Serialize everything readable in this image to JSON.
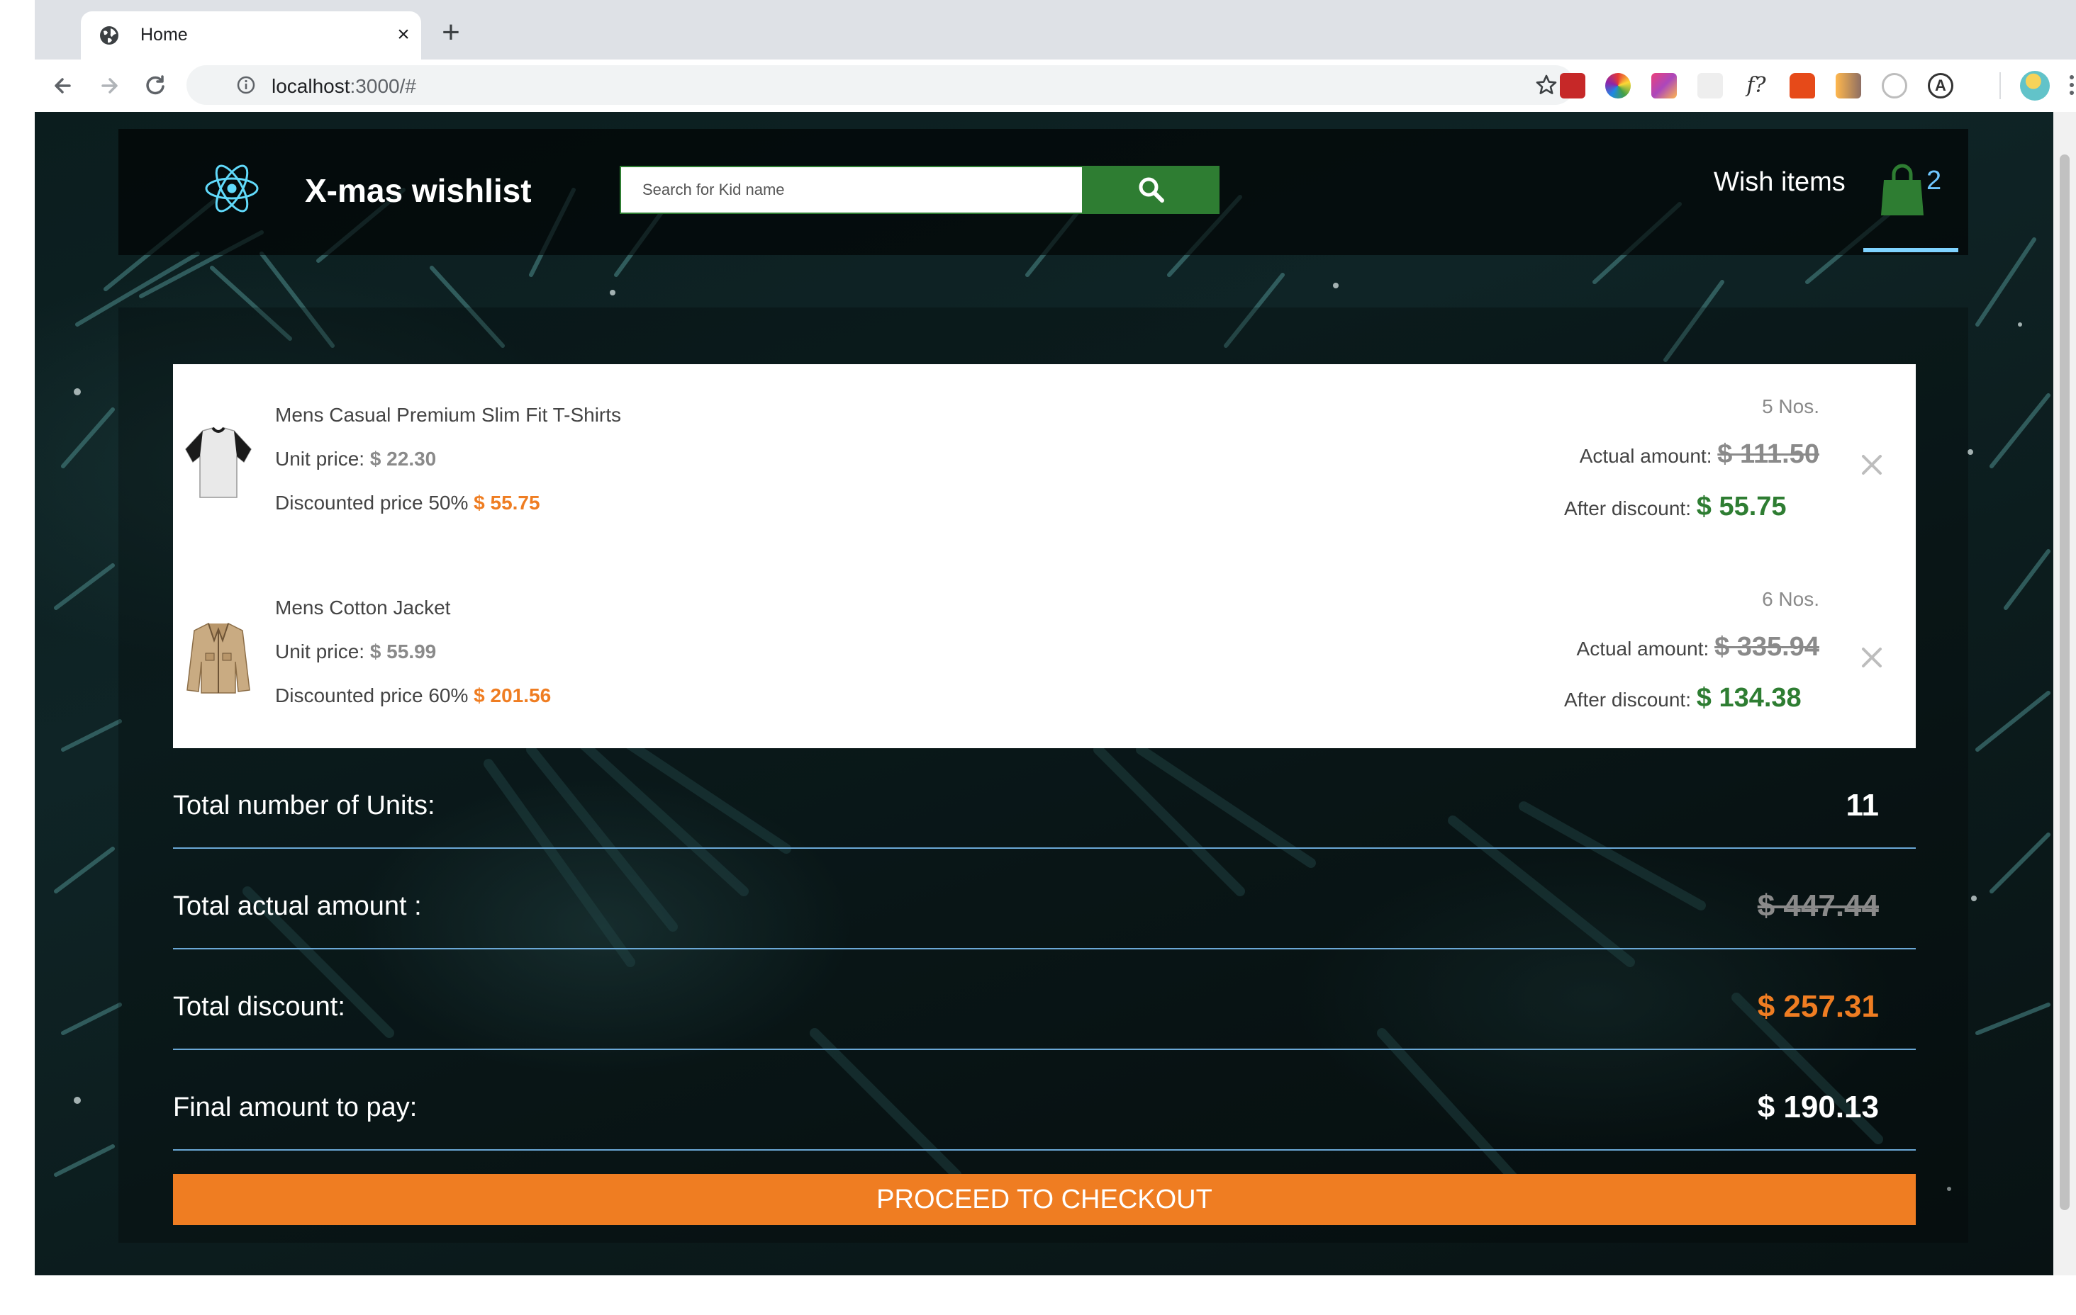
{
  "browser": {
    "tab_title": "Home",
    "url_host": "localhost",
    "url_rest": ":3000/#",
    "icons": [
      "globe-icon",
      "close-icon",
      "plus-icon",
      "back-icon",
      "forward-icon",
      "reload-icon",
      "info-icon",
      "star-icon",
      "kebab-icon"
    ]
  },
  "header": {
    "title": "X-mas wishlist",
    "search_placeholder": "Search for Kid name",
    "wish_label": "Wish items",
    "cart_count": "2",
    "accent_green": "#2e7d32"
  },
  "items": [
    {
      "name": "Mens Casual Premium Slim Fit T-Shirts",
      "unit_label": "Unit price:",
      "unit_price": "$ 22.30",
      "discount_label": "Discounted price 50%",
      "discount_value": "$ 55.75",
      "qty": "5 Nos.",
      "actual_label": "Actual amount:",
      "actual_amount": "$ 111.50",
      "after_label": "After discount:",
      "after_amount": "$ 55.75"
    },
    {
      "name": "Mens Cotton Jacket",
      "unit_label": "Unit price:",
      "unit_price": "$ 55.99",
      "discount_label": "Discounted price 60%",
      "discount_value": "$ 201.56",
      "qty": "6 Nos.",
      "actual_label": "Actual amount:",
      "actual_amount": "$ 335.94",
      "after_label": "After discount:",
      "after_amount": "$ 134.38"
    }
  ],
  "summary": {
    "units_label": "Total number of Units:",
    "units_value": "11",
    "actual_label": "Total actual amount :",
    "actual_value": "$ 447.44",
    "discount_label": "Total discount:",
    "discount_value": "$ 257.31",
    "final_label": "Final amount to pay:",
    "final_value": "$ 190.13"
  },
  "checkout_label": "PROCEED TO CHECKOUT",
  "colors": {
    "orange": "#ef7d22",
    "divider": "#6ba8d6"
  }
}
